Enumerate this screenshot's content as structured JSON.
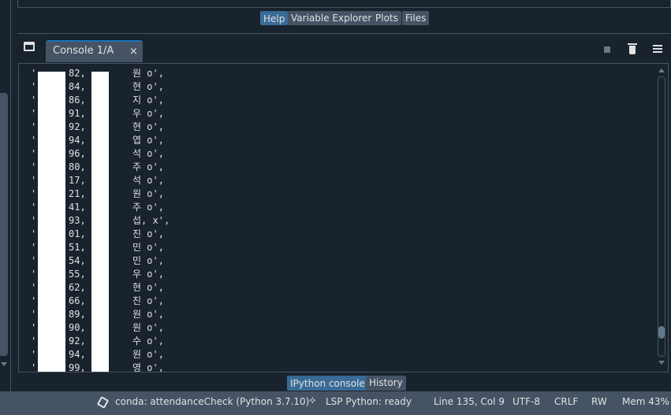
{
  "top_tabs": [
    {
      "label": "Help",
      "active": true
    },
    {
      "label": "Variable Explorer",
      "active": false
    },
    {
      "label": "Plots",
      "active": false
    },
    {
      "label": "Files",
      "active": false
    }
  ],
  "console": {
    "tab_label": "Console 1/A",
    "close_glyph": "×",
    "lines": [
      {
        "q": "'",
        "num": "82,",
        "rest": "원 o',"
      },
      {
        "q": "'",
        "num": "84,",
        "rest": "현 o',"
      },
      {
        "q": "'",
        "num": "86,",
        "rest": "지 o',"
      },
      {
        "q": "'",
        "num": "91,",
        "rest": "우 o',"
      },
      {
        "q": "'",
        "num": "92,",
        "rest": "현 o',"
      },
      {
        "q": "'",
        "num": "94,",
        "rest": "엽 o',"
      },
      {
        "q": "'",
        "num": "96,",
        "rest": "석 o',"
      },
      {
        "q": "'",
        "num": "80,",
        "rest": "주 o',"
      },
      {
        "q": "'",
        "num": "17,",
        "rest": "석 o',"
      },
      {
        "q": "'",
        "num": "21,",
        "rest": "원 o',"
      },
      {
        "q": "'",
        "num": "41,",
        "rest": "주 o',"
      },
      {
        "q": "'",
        "num": "93,",
        "rest": "섭, x',"
      },
      {
        "q": "'",
        "num": "01,",
        "rest": "진 o',"
      },
      {
        "q": "'",
        "num": "51,",
        "rest": "민 o',"
      },
      {
        "q": "'",
        "num": "54,",
        "rest": "민 o',"
      },
      {
        "q": "'",
        "num": "55,",
        "rest": "우 o',"
      },
      {
        "q": "'",
        "num": "62,",
        "rest": "현 o',"
      },
      {
        "q": "'",
        "num": "66,",
        "rest": "진 o',"
      },
      {
        "q": "'",
        "num": "89,",
        "rest": "원 o',"
      },
      {
        "q": "'",
        "num": "90,",
        "rest": "원 o',"
      },
      {
        "q": "'",
        "num": "92,",
        "rest": "수 o',"
      },
      {
        "q": "'",
        "num": "94,",
        "rest": "원 o',"
      },
      {
        "q": "'",
        "num": "99,",
        "rest": "영 o',"
      }
    ]
  },
  "bottom_tabs": [
    {
      "label": "IPython console",
      "active": true
    },
    {
      "label": "History",
      "active": false
    }
  ],
  "status_bar": {
    "conda": "conda: attendanceCheck (Python 3.7.10)",
    "lsp": "LSP Python: ready",
    "position": "Line 135, Col 9",
    "encoding": "UTF-8",
    "eol": "CRLF",
    "permissions": "RW",
    "memory": "Mem 43%"
  },
  "colors": {
    "background": "#19232d",
    "panel": "#455364",
    "accent": "#346792",
    "text": "#e0e1e3"
  }
}
